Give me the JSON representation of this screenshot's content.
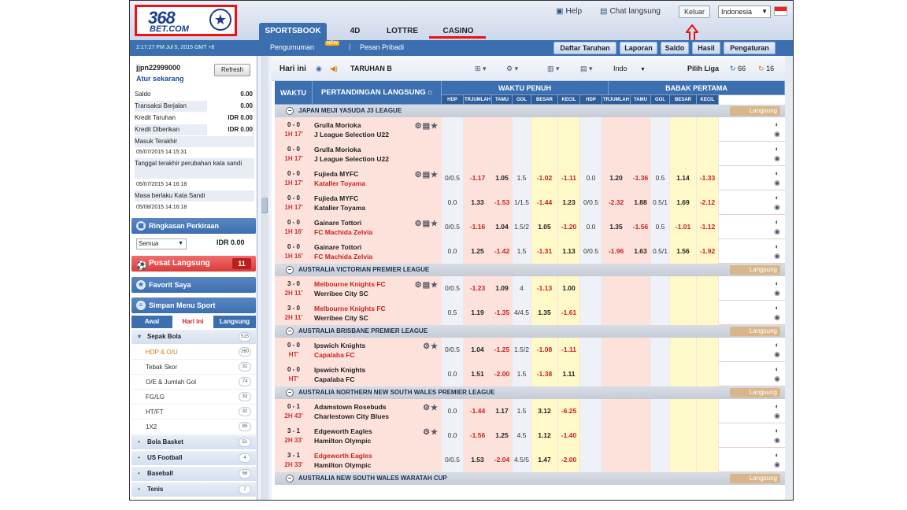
{
  "header": {
    "logo_line1": "368",
    "logo_line2": "BET.COM",
    "help": "Help",
    "chat": "Chat langsung",
    "logout": "Keluar",
    "language": "Indonesia",
    "tabs": [
      "SPORTSBOOK",
      "4D",
      "LOTTRE",
      "CASINO"
    ],
    "datetime": "2:17:27 PM Jul 5, 2015 GMT +8"
  },
  "nav": {
    "announcement": "Pengumuman",
    "new_badge": "NEW",
    "sep": "|",
    "private_msg": "Pesan Pribadi",
    "buttons": [
      "Daftar Taruhan",
      "Laporan",
      "Saldo",
      "Hasil",
      "Pengaturan"
    ]
  },
  "account": {
    "username": "jjpn22999000",
    "setup_link": "Atur sekarang",
    "refresh": "Refresh",
    "rows": [
      {
        "label": "Saldo",
        "value": "0.00"
      },
      {
        "label": "Transaksi Berjalan",
        "value": "0.00"
      },
      {
        "label": "Kredit Taruhan",
        "value": "IDR 0.00"
      },
      {
        "label": "Kredit Diberikan",
        "value": "IDR 0.00"
      }
    ],
    "last_login_label": "Masuk Terakhir",
    "last_login": "05/07/2015 14:15:31",
    "pwd_changed_label": "Tanggal terakhir perubahan kata sandi",
    "pwd_changed": "05/07/2015 14:16:18",
    "pwd_valid_label": "Masa berlaku Kata Sandi",
    "pwd_valid": "05/08/2015 14:16:18"
  },
  "panels": {
    "estimate": "Ringkasan Perkiraan",
    "select": "Semua",
    "estimate_value": "IDR 0.00",
    "live_center": "Pusat Langsung",
    "live_count": "11",
    "favorite": "Favorit Saya",
    "sport_menu": "Simpan Menu Sport",
    "subtabs": [
      "Awal",
      "Hari ini",
      "Langsung"
    ]
  },
  "sports": [
    {
      "name": "Sepak Bola",
      "count": "515"
    },
    {
      "name": "Bola Basket",
      "count": "51"
    },
    {
      "name": "US Football",
      "count": "4"
    },
    {
      "name": "Baseball",
      "count": "66"
    },
    {
      "name": "Tenis",
      "count": "7"
    }
  ],
  "soccer_sub": [
    {
      "name": "HDP & O/U",
      "count": "260"
    },
    {
      "name": "Tebak Skor",
      "count": "32"
    },
    {
      "name": "O/E & Jumlah Gol",
      "count": "74"
    },
    {
      "name": "FG/LG",
      "count": "32"
    },
    {
      "name": "HT/FT",
      "count": "32"
    },
    {
      "name": "1X2",
      "count": "85"
    }
  ],
  "toolbar": {
    "today": "Hari ini",
    "bet_type": "TARUHAN B",
    "odds_type": "Indo",
    "select_league": "Pilih Liga",
    "refresh_live": "66",
    "refresh_today": "16"
  },
  "table_head": {
    "time": "WAKTU",
    "match": "PERTANDINGAN LANGSUNG",
    "full": "WAKTU PENUH",
    "half": "BABAK PERTAMA",
    "sub": [
      "HDP",
      "TRJUMLAH",
      "TAMU",
      "GOL",
      "BESAR",
      "KECIL"
    ],
    "live_tag": "Langsung"
  },
  "leagues": [
    {
      "name": "JAPAN MEIJI YASUDA J3 LEAGUE",
      "matches": [
        {
          "score": "0 - 0",
          "time": "1H 17'",
          "home": "Grulla Morioka",
          "away": "J League Selection U22",
          "red": "",
          "icons": "⚙▤★",
          "cells": [
            "",
            "",
            "",
            "",
            "",
            "",
            "",
            "",
            "",
            "",
            "",
            ""
          ]
        },
        {
          "score": "0 - 0",
          "time": "1H 17'",
          "home": "Grulla Morioka",
          "away": "J League Selection U22",
          "red": "",
          "icons": "",
          "cells": [
            "",
            "",
            "",
            "",
            "",
            "",
            "",
            "",
            "",
            "",
            "",
            ""
          ]
        },
        {
          "score": "0 - 0",
          "time": "1H 17'",
          "home": "Fujieda MYFC",
          "away": "Kataller Toyama",
          "red": "away",
          "icons": "⚙▤★",
          "cells": [
            "0/0.5",
            "-1.17",
            "1.05",
            "1.5",
            "-1.02",
            "-1.11",
            "0.0",
            "1.20",
            "-1.36",
            "0.5",
            "1.14",
            "-1.33"
          ]
        },
        {
          "score": "0 - 0",
          "time": "1H 17'",
          "home": "Fujieda MYFC",
          "away": "Kataller Toyama",
          "red": "",
          "icons": "",
          "cells": [
            "0.0",
            "1.33",
            "-1.53",
            "1/1.5",
            "-1.44",
            "1.23",
            "0/0.5",
            "-2.32",
            "1.88",
            "0.5/1",
            "1.69",
            "-2.12"
          ]
        },
        {
          "score": "0 - 0",
          "time": "1H 16'",
          "home": "Gainare Tottori",
          "away": "FC Machida Zelvia",
          "red": "away",
          "icons": "⚙▤★",
          "cells": [
            "0/0.5",
            "-1.16",
            "1.04",
            "1.5/2",
            "1.05",
            "-1.20",
            "0.0",
            "1.35",
            "-1.56",
            "0.5",
            "-1.01",
            "-1.12"
          ]
        },
        {
          "score": "0 - 0",
          "time": "1H 16'",
          "home": "Gainare Tottori",
          "away": "FC Machida Zelvia",
          "red": "away",
          "icons": "",
          "cells": [
            "0.0",
            "1.25",
            "-1.42",
            "1.5",
            "-1.31",
            "1.13",
            "0/0.5",
            "-1.96",
            "1.63",
            "0.5/1",
            "1.56",
            "-1.92"
          ]
        }
      ]
    },
    {
      "name": "AUSTRALIA VICTORIAN PREMIER LEAGUE",
      "matches": [
        {
          "score": "3 - 0",
          "time": "2H 11'",
          "home": "Melbourne Knights FC",
          "away": "Werribee City SC",
          "red": "home",
          "icons": "⚙▤★",
          "cells": [
            "0/0.5",
            "-1.23",
            "1.09",
            "4",
            "-1.13",
            "1.00",
            "",
            "",
            "",
            "",
            "",
            ""
          ]
        },
        {
          "score": "3 - 0",
          "time": "2H 11'",
          "home": "Melbourne Knights FC",
          "away": "Werribee City SC",
          "red": "home",
          "icons": "",
          "cells": [
            "0.5",
            "1.19",
            "-1.35",
            "4/4.5",
            "1.35",
            "-1.61",
            "",
            "",
            "",
            "",
            "",
            ""
          ]
        }
      ]
    },
    {
      "name": "AUSTRALIA BRISBANE PREMIER LEAGUE",
      "matches": [
        {
          "score": "0 - 0",
          "time": "HT'",
          "home": "Ipswich Knights",
          "away": "Capalaba FC",
          "red": "away",
          "icons": "⚙★",
          "cells": [
            "0/0.5",
            "1.04",
            "-1.25",
            "1.5/2",
            "-1.08",
            "-1.11",
            "",
            "",
            "",
            "",
            "",
            ""
          ]
        },
        {
          "score": "0 - 0",
          "time": "HT'",
          "home": "Ipswich Knights",
          "away": "Capalaba FC",
          "red": "",
          "icons": "",
          "cells": [
            "0.0",
            "1.51",
            "-2.00",
            "1.5",
            "-1.38",
            "1.11",
            "",
            "",
            "",
            "",
            "",
            ""
          ]
        }
      ]
    },
    {
      "name": "AUSTRALIA NORTHERN NEW SOUTH WALES PREMIER LEAGUE",
      "matches": [
        {
          "score": "0 - 1",
          "time": "2H 43'",
          "home": "Adamstown Rosebuds",
          "away": "Charlestown City Blues",
          "red": "",
          "icons": "⚙★",
          "cells": [
            "0.0",
            "-1.44",
            "1.17",
            "1.5",
            "3.12",
            "-6.25",
            "",
            "",
            "",
            "",
            "",
            ""
          ]
        },
        {
          "score": "3 - 1",
          "time": "2H 33'",
          "home": "Edgeworth Eagles",
          "away": "Hamilton Olympic",
          "red": "",
          "icons": "⚙★",
          "cells": [
            "0.0",
            "-1.56",
            "1.25",
            "4.5",
            "1.12",
            "-1.40",
            "",
            "",
            "",
            "",
            "",
            ""
          ]
        },
        {
          "score": "3 - 1",
          "time": "2H 33'",
          "home": "Edgeworth Eagles",
          "away": "Hamilton Olympic",
          "red": "home",
          "icons": "",
          "cells": [
            "0/0.5",
            "1.53",
            "-2.04",
            "4.5/5",
            "1.47",
            "-2.00",
            "",
            "",
            "",
            "",
            "",
            ""
          ]
        }
      ]
    },
    {
      "name": "AUSTRALIA NEW SOUTH WALES WARATAH CUP",
      "matches": []
    }
  ],
  "colors": {
    "brand_blue": "#3b6fb0",
    "highlight_red": "#e11111",
    "row_pink": "#fde2dc",
    "odds_yellow": "#fff8c8"
  }
}
